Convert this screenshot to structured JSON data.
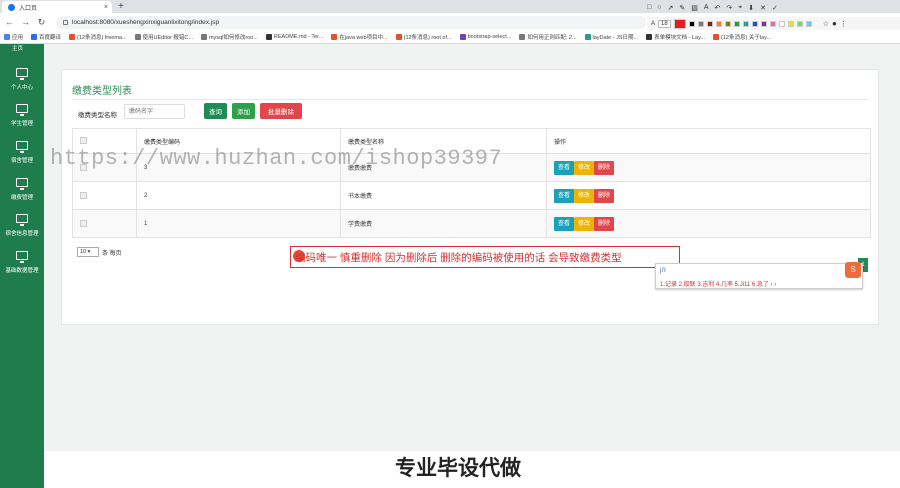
{
  "browser": {
    "tab_title": "入口页",
    "url": "localhost:8080/xueshengxinxiguanlixitong/index.jsp",
    "bookmarks": [
      "应用",
      "百度翻译",
      "(12条消息) freema...",
      "使用UEditor 报错C...",
      "mysql如何修改roo...",
      "README.md - Ter...",
      "在java web项目中...",
      "(12条消息) root of...",
      "bootstrap-select...",
      "如何用正则匹配: 2...",
      "layDate - JS日期...",
      "表单模块文档 - Lay...",
      "(12条消息) 关于lay..."
    ]
  },
  "toolbar": {
    "font_size": "18"
  },
  "sidebar": {
    "top_label": "主页",
    "items": [
      "个人中心",
      "学生管理",
      "宿舍管理",
      "缴费管理",
      "宿舍信息管理",
      "基础数据管理"
    ]
  },
  "page": {
    "title": "缴费类型列表",
    "search_label": "缴费类型名称",
    "search_placeholder": "缴码名字",
    "btn_query": "查询",
    "btn_add": "添加",
    "btn_batch_delete": "批量删除",
    "headers": [
      "",
      "缴费类型编码",
      "缴费类型名称",
      "操作"
    ],
    "rows": [
      {
        "code": "3",
        "name": "缴费缴费"
      },
      {
        "code": "2",
        "name": "书本缴费"
      },
      {
        "code": "1",
        "name": "学费缴费"
      }
    ],
    "op_view": "查看",
    "op_edit": "修改",
    "op_delete": "删除",
    "page_size": "10",
    "page_size_suffix": "条 每页",
    "page_number": "1"
  },
  "watermark": "https://www.huzhan.com/ishop39397",
  "annotation": "编码唯一 慎重删除 因为删除后 删除的编码被使用的话 会导致缴费类型",
  "ime": {
    "input": "ji'l",
    "candidates": "1.记录  2.级联  3.吉利  4.几率  5.Ji11  6.急了  ‹  ›"
  },
  "slogan": "专业毕设代做"
}
